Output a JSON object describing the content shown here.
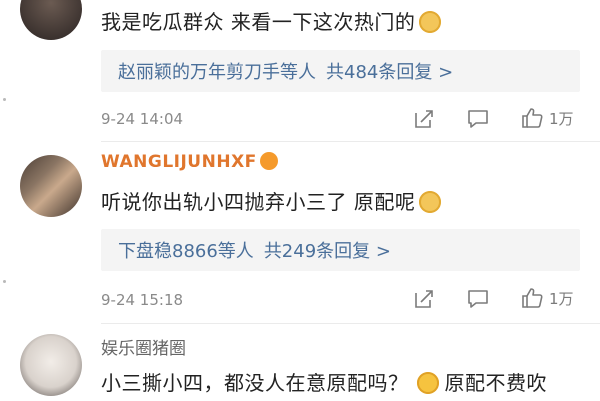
{
  "comments": [
    {
      "text": "我是吃瓜群众 来看一下这次热门的",
      "reply_names": "赵丽颖的万年剪刀手等人",
      "reply_count": "共484条回复 >",
      "time": "9-24 14:04",
      "likes": "1万"
    },
    {
      "username": "WANGLIJUNHXF",
      "text": "听说你出轨小四抛弃小三了 原配呢",
      "reply_names": "下盘稳8866等人",
      "reply_count": "共249条回复 >",
      "time": "9-24 15:18",
      "likes": "1万"
    },
    {
      "username": "娱乐圈猪圈",
      "text_part1": "小三撕小四，都没人在意原配吗？",
      "text_part2": "原配不费吹"
    }
  ],
  "icons": {
    "share": "share-icon",
    "comment": "comment-icon",
    "like": "thumbs-up-icon",
    "emoji_doge": "doge-emoji-icon",
    "emoji_laugh": "laugh-cry-emoji-icon",
    "vip": "vip-badge-icon"
  },
  "colors": {
    "link": "#4a6f9a",
    "username_orange": "#e0762d",
    "meta_gray": "#8a8a8a"
  }
}
